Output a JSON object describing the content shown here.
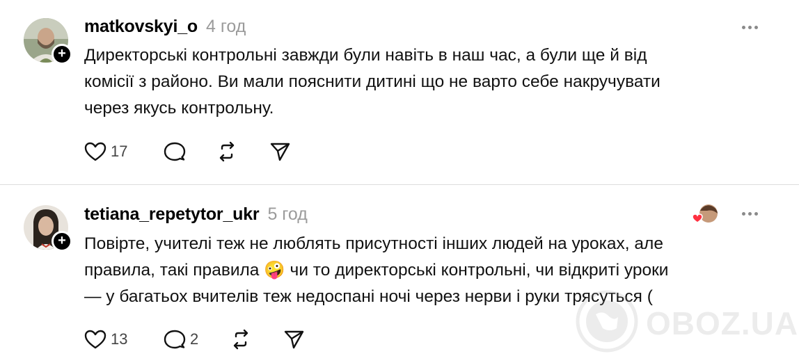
{
  "posts": [
    {
      "username": "matkovskyi_o",
      "time": "4 год",
      "follow": "+",
      "lines": [
        "Директорські контрольні завжди були навіть в наш час, а були ще й від",
        "комісії з районо. Ви мали пояснити дитині що не варто себе накручувати",
        "через якусь контрольну."
      ],
      "likes": "17",
      "replies": ""
    },
    {
      "username": "tetiana_repetytor_ukr",
      "time": "5 год",
      "follow": "+",
      "lines": [
        "Повірте, учителі теж не люблять присутності інших людей на уроках, але",
        "правила, такі правила 🤪 чи то директорські контрольні, чи відкриті уроки",
        "— у багатьох вчителів теж недоспані ночі через нерви і руки трясуться ("
      ],
      "likes": "13",
      "replies": "2"
    }
  ],
  "watermark": "OBOZ.UA",
  "icons": {
    "like": "heart-icon",
    "reply": "comment-icon",
    "repost": "repost-icon",
    "share": "send-icon",
    "more": "more-icon"
  },
  "colors": {
    "text": "#111111",
    "muted": "#9b9b9b",
    "heart_reaction": "#ff3040"
  }
}
